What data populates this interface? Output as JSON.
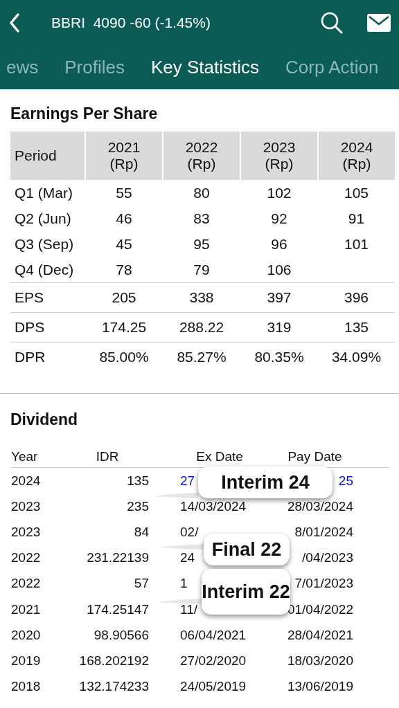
{
  "header": {
    "title": "BBRI  4090 -60 (-1.45%)"
  },
  "tabs": [
    {
      "label": "ews",
      "selected": false
    },
    {
      "label": "Profiles",
      "selected": false
    },
    {
      "label": "Key Statistics",
      "selected": true
    },
    {
      "label": "Corp Action",
      "selected": false
    }
  ],
  "eps": {
    "title": "Earnings Per Share",
    "columns": [
      {
        "label": "Period"
      },
      {
        "label": "2021",
        "unit": "(Rp)"
      },
      {
        "label": "2022",
        "unit": "(Rp)"
      },
      {
        "label": "2023",
        "unit": "(Rp)"
      },
      {
        "label": "2024",
        "unit": "(Rp)"
      }
    ],
    "rows": [
      {
        "kind": "quarter",
        "period": "Q1 (Mar)",
        "values": [
          "55",
          "80",
          "102",
          "105"
        ]
      },
      {
        "kind": "quarter",
        "period": "Q2 (Jun)",
        "values": [
          "46",
          "83",
          "92",
          "91"
        ]
      },
      {
        "kind": "quarter",
        "period": "Q3 (Sep)",
        "values": [
          "45",
          "95",
          "96",
          "101"
        ]
      },
      {
        "kind": "quarter",
        "period": "Q4 (Dec)",
        "values": [
          "78",
          "79",
          "106"
        ]
      },
      {
        "kind": "summary",
        "period": "EPS",
        "values": [
          "205",
          "338",
          "397",
          "396"
        ]
      },
      {
        "kind": "summary",
        "period": "DPS",
        "values": [
          "174.25",
          "288.22",
          "319",
          "135"
        ]
      },
      {
        "kind": "summary",
        "period": "DPR",
        "values": [
          "85.00%",
          "85.27%",
          "80.35%",
          "34.09%"
        ]
      }
    ]
  },
  "dividend": {
    "title": "Dividend",
    "columns": [
      "Year",
      "IDR",
      "Ex Date",
      "Pay Date"
    ],
    "rows": [
      {
        "year": "2024",
        "idr": "135",
        "ex_date": "27",
        "pay_date": "25",
        "highlighted": true
      },
      {
        "year": "2023",
        "idr": "235",
        "ex_date": "14/03/2024",
        "pay_date": "28/03/2024",
        "highlighted": false
      },
      {
        "year": "2023",
        "idr": "84",
        "ex_date": "02/",
        "pay_date": "8/01/2024",
        "highlighted": false
      },
      {
        "year": "2022",
        "idr": "231.22139",
        "ex_date": "24",
        "pay_date": "/04/2023",
        "highlighted": false
      },
      {
        "year": "2022",
        "idr": "57",
        "ex_date": "1",
        "pay_date": "7/01/2023",
        "highlighted": false
      },
      {
        "year": "2021",
        "idr": "174.25147",
        "ex_date": "11/",
        "pay_date": "01/04/2022",
        "highlighted": false
      },
      {
        "year": "2020",
        "idr": "98.90566",
        "ex_date": "06/04/2021",
        "pay_date": "28/04/2021",
        "highlighted": false
      },
      {
        "year": "2019",
        "idr": "168.202192",
        "ex_date": "27/02/2020",
        "pay_date": "18/03/2020",
        "highlighted": false
      },
      {
        "year": "2018",
        "idr": "132.174233",
        "ex_date": "24/05/2019",
        "pay_date": "13/06/2019",
        "highlighted": false
      }
    ],
    "callouts": [
      {
        "text": "Interim 24"
      },
      {
        "text": "Final 22"
      },
      {
        "text": "Interim 22"
      }
    ]
  }
}
